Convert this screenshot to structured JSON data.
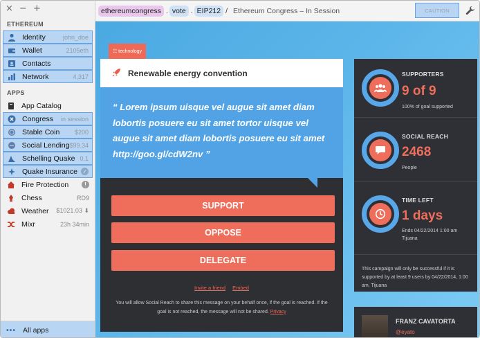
{
  "window": {
    "controls": [
      "×",
      "−",
      "+"
    ]
  },
  "sidebar": {
    "section_ethereum": "ETHEREUM",
    "ethereum_items": [
      {
        "label": "Identity",
        "meta": "john_doe",
        "icon": "person-icon",
        "icon_color": "#3a6ea8"
      },
      {
        "label": "Wallet",
        "meta": "2105eth",
        "icon": "wallet-icon",
        "icon_color": "#3a6ea8"
      },
      {
        "label": "Contacts",
        "meta": "",
        "icon": "contacts-icon",
        "icon_color": "#3a6ea8"
      },
      {
        "label": "Network",
        "meta": "4,317",
        "icon": "bar-chart-icon",
        "icon_color": "#3a6ea8"
      }
    ],
    "section_apps": "APPS",
    "app_items": [
      {
        "label": "App Catalog",
        "meta": "",
        "icon": "catalog-icon",
        "icon_color": "#333"
      },
      {
        "label": "Congress",
        "meta": "in session",
        "icon": "congress-icon",
        "icon_color": "#3a6ea8"
      },
      {
        "label": "Stable Coin",
        "meta": "$200",
        "icon": "coin-icon",
        "icon_color": "#3a6ea8"
      },
      {
        "label": "Social Lending",
        "meta": "$99.34",
        "icon": "lending-icon",
        "icon_color": "#3a6ea8"
      },
      {
        "label": "Schelling Quake",
        "meta": "0.1",
        "icon": "quake-icon",
        "icon_color": "#3a6ea8"
      },
      {
        "label": "Quake Insurance",
        "meta": "✓",
        "icon": "insurance-icon",
        "icon_color": "#3a6ea8"
      },
      {
        "label": "Fire Protection",
        "meta": "!",
        "icon": "fire-icon",
        "icon_color": "#c0392b"
      },
      {
        "label": "Chess",
        "meta": "RD9",
        "icon": "chess-icon",
        "icon_color": "#c0392b"
      },
      {
        "label": "Weather",
        "meta": "$1021.03 ⬇",
        "icon": "cloud-icon",
        "icon_color": "#c0392b"
      },
      {
        "label": "Mixr",
        "meta": "23h 34min",
        "icon": "shuffle-icon",
        "icon_color": "#c0392b"
      }
    ],
    "all_apps": "All apps",
    "all_apps_dots": "•••"
  },
  "topbar": {
    "crumbs": [
      "ethereumcongress",
      "vote",
      "EIP212"
    ],
    "separators": [
      ".",
      ".",
      "/"
    ],
    "title": "Ethereum Congress – In Session",
    "caution": "CAUTION",
    "wrench": "🔧"
  },
  "main": {
    "tag": "☷ technology",
    "card_title": "Renewable energy convention",
    "quote": "“ Lorem ipsum uisque vel augue sit amet diam lobortis posuere eu sit amet tortor uisque vel augue sit amet diam lobortis posuere eu sit amet http://goo.gl/cdW2nv ”",
    "buttons": [
      "SUPPORT",
      "OPPOSE",
      "DELEGATE"
    ],
    "link_invite": "Invite a friend",
    "link_embed": "Embed",
    "notice": "You will allow Social Reach to share this message on your behalf once, if the goal is reached. If the goal is not reached, the message will not be shared.",
    "privacy": "Privacy"
  },
  "stats": {
    "supporters_label": "SUPPORTERS",
    "supporters_value": "9 of 9",
    "supporters_sub": "100% of goal supported",
    "reach_label": "SOCIAL REACH",
    "reach_value": "2468",
    "reach_sub": "People",
    "time_label": "TIME LEFT",
    "time_value": "1 days",
    "time_sub": "Ends 04/22/2014 1:00 am Tijuana",
    "note": "This campaign will only be successful if it is supported by at least 9 users by 04/22/2014, 1:00 am, Tijuana"
  },
  "profile": {
    "name": "FRANZ CAVATORTA",
    "handle": "@eyato"
  },
  "colors": {
    "accent_red": "#ef6d5b",
    "accent_blue": "#52a3e6",
    "dark_panel": "#2e2f33",
    "highlight": "#b8d6f3"
  }
}
